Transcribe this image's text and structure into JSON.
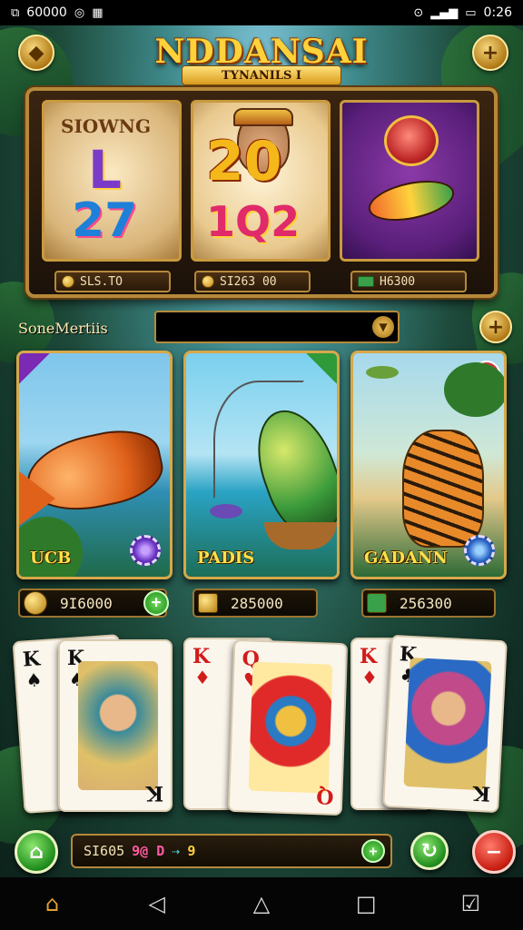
{
  "status_bar": {
    "left_text": "60000",
    "time": "0:26"
  },
  "header": {
    "title": "NDDANSAI",
    "subtitle": "TYNANILS I",
    "left_button_icon": "diamond-icon",
    "right_button_icon": "plus-icon"
  },
  "top_slots": [
    {
      "label": "SIOWNG",
      "symbol_top": "L",
      "symbol_bottom": "27",
      "value": "SLS.TO"
    },
    {
      "label": "",
      "symbol_top": "20",
      "symbol_bottom": "1Q2",
      "value": "SI263 00"
    },
    {
      "label": "",
      "symbol_top": "",
      "symbol_bottom": "",
      "value": "H6300"
    }
  ],
  "section": {
    "label": "SoneMertiis",
    "search_value": ""
  },
  "games": [
    {
      "label": "UCB",
      "balance": "9I6000"
    },
    {
      "label": "PADIS",
      "balance": "285000"
    },
    {
      "label": "GADANN",
      "balance": "256300"
    }
  ],
  "hand": [
    {
      "rank": "K",
      "suit": "♠",
      "color": "black"
    },
    {
      "rank": "K",
      "suit": "♠",
      "color": "black"
    },
    {
      "rank": "K",
      "suit": "♦",
      "color": "red"
    },
    {
      "rank": "Q",
      "suit": "♥",
      "color": "red"
    },
    {
      "rank": "K",
      "suit": "♦",
      "color": "red"
    },
    {
      "rank": "K",
      "suit": "♣",
      "color": "black"
    }
  ],
  "bet_bar": {
    "value": "SI605",
    "chips": "9@ D",
    "extra": "9"
  },
  "nav": {
    "home": "home-icon",
    "back": "back-icon",
    "home2": "home-outline-icon",
    "recents": "recents-icon",
    "notes": "notes-icon"
  }
}
